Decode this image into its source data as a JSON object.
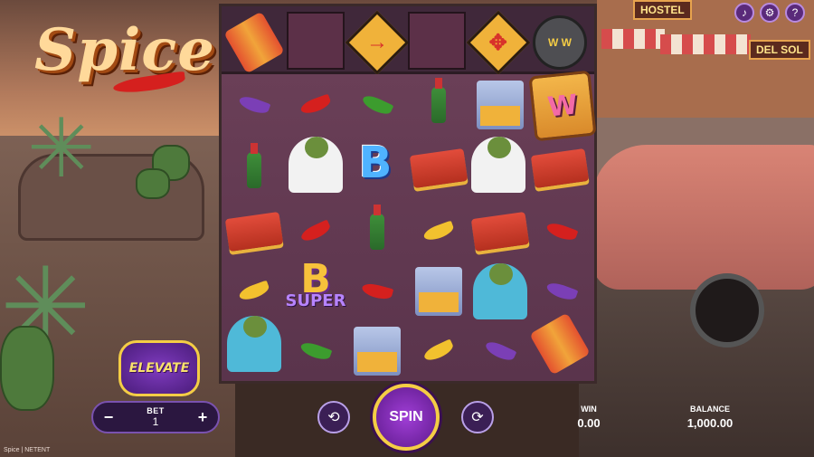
{
  "game": {
    "logo_text": "Spice",
    "footer_text": "Spice | NETENT",
    "elevate_label": "ELEVATE"
  },
  "top_bar": {
    "sound_icon": "speaker-icon",
    "settings_icon": "gear-icon",
    "help_icon": "question-icon"
  },
  "scenery": {
    "hostel_sign": "HOSTEL",
    "del_sol_sign": "DEL SOL"
  },
  "top_row": {
    "cells": [
      "dynamite",
      "empty",
      "arrow-sign",
      "empty",
      "cross-arrow-sign",
      "revolver-wild"
    ],
    "revolver_label": "W W"
  },
  "reels": {
    "wild_lock_label": "W",
    "b_label": "B",
    "b_super_label": "B",
    "b_super_sub": "SUPER"
  },
  "controls": {
    "bet_label": "BET",
    "bet_value": "1",
    "bet_minus": "−",
    "bet_plus": "+",
    "spin_label": "SPIN",
    "turbo_icon": "turbo-icon",
    "autoplay_icon": "autoplay-icon"
  },
  "stats": {
    "win_label": "WIN",
    "win_value": "0.00",
    "balance_label": "BALANCE",
    "balance_value": "1,000.00"
  },
  "colors": {
    "accent_purple": "#5e1a8c",
    "gold": "#f4cd45",
    "reel_bg": "#6a3f57"
  }
}
